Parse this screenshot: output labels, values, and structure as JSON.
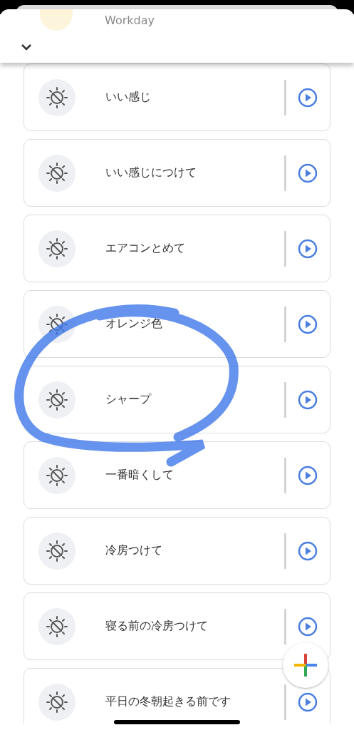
{
  "routines": [
    {
      "label": "Workday",
      "kind": "featured"
    },
    {
      "label": "いい感じ",
      "kind": "custom"
    },
    {
      "label": "いい感じにつけて",
      "kind": "custom"
    },
    {
      "label": "エアコンとめて",
      "kind": "custom"
    },
    {
      "label": "オレンジ色",
      "kind": "custom"
    },
    {
      "label": "シャープ",
      "kind": "custom"
    },
    {
      "label": "一番暗くして",
      "kind": "custom"
    },
    {
      "label": "冷房つけて",
      "kind": "custom"
    },
    {
      "label": "寝る前の冷房つけて",
      "kind": "custom"
    },
    {
      "label": "平日の冬朝起きる前です",
      "kind": "custom"
    }
  ]
}
